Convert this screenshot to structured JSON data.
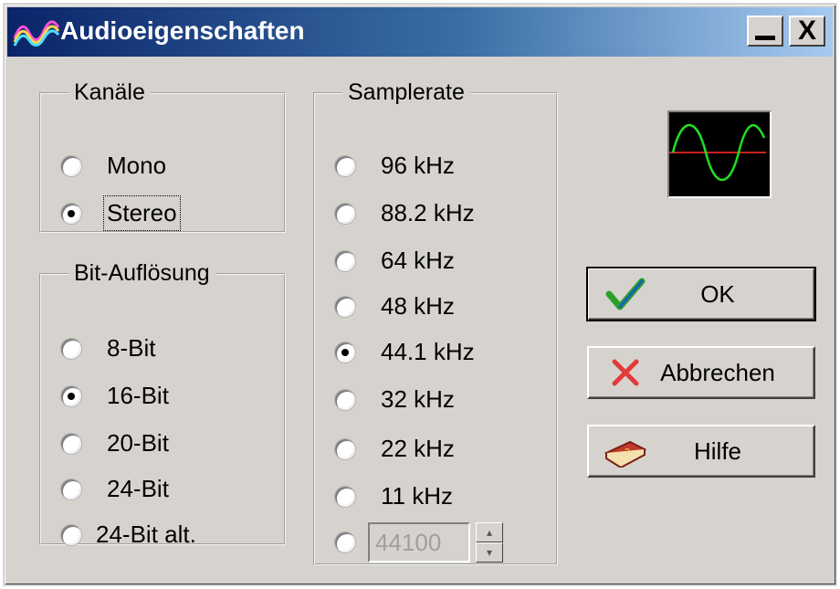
{
  "window": {
    "title": "Audioeigenschaften",
    "minimize_label": "_",
    "close_label": "X"
  },
  "channels": {
    "legend": "Kanäle",
    "options": [
      {
        "label": "Mono",
        "checked": false
      },
      {
        "label": "Stereo",
        "checked": true
      }
    ]
  },
  "bit_resolution": {
    "legend": "Bit-Auflösung",
    "options": [
      {
        "label": "8-Bit",
        "checked": false
      },
      {
        "label": "16-Bit",
        "checked": true
      },
      {
        "label": "20-Bit",
        "checked": false
      },
      {
        "label": "24-Bit",
        "checked": false
      },
      {
        "label": "24-Bit alt.",
        "checked": false
      }
    ]
  },
  "samplerate": {
    "legend": "Samplerate",
    "options": [
      {
        "label": "96 kHz",
        "checked": false
      },
      {
        "label": "88.2 kHz",
        "checked": false
      },
      {
        "label": "64 kHz",
        "checked": false
      },
      {
        "label": "48 kHz",
        "checked": false
      },
      {
        "label": "44.1 kHz",
        "checked": true
      },
      {
        "label": "32 kHz",
        "checked": false
      },
      {
        "label": "22 kHz",
        "checked": false
      },
      {
        "label": "11 kHz",
        "checked": false
      }
    ],
    "custom_value": "44100"
  },
  "buttons": {
    "ok": "OK",
    "cancel": "Abbrechen",
    "help": "Hilfe"
  },
  "icons": {
    "title": "audio-wave-icon",
    "preview": "sine-wave-preview",
    "ok": "checkmark-icon",
    "cancel": "x-icon",
    "help": "book-icon"
  },
  "colors": {
    "title_gradient_start": "#0a246a",
    "title_gradient_end": "#a6caf0",
    "dialog_face": "#d6d3ce",
    "scope_wave": "#22dd22",
    "scope_axis": "#cc2222"
  }
}
